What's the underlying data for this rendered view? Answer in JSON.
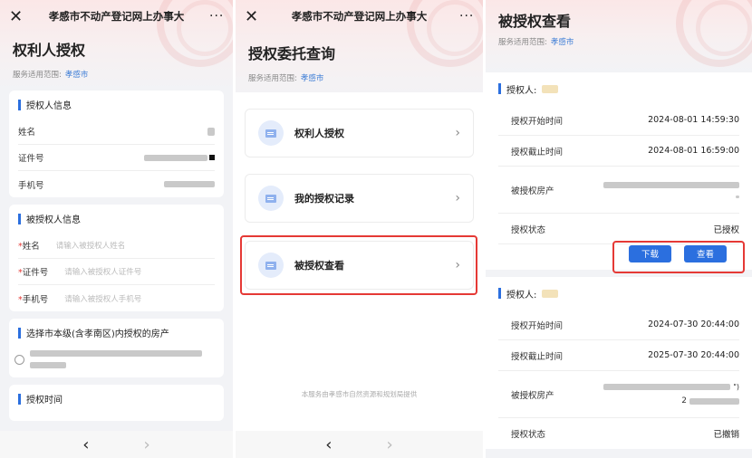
{
  "panel1": {
    "window_title": "孝感市不动产登记网上办事大",
    "close_glyph": "✕",
    "more_glyph": "···",
    "page_title": "权利人授权",
    "scope_label": "服务适用范围:",
    "scope_value": "孝感市",
    "grantor_section": {
      "title": "授权人信息",
      "fields": [
        {
          "label": "姓名"
        },
        {
          "label": "证件号"
        },
        {
          "label": "手机号"
        }
      ]
    },
    "grantee_section": {
      "title": "被授权人信息",
      "fields": [
        {
          "required": "*",
          "label": "姓名",
          "placeholder": "请输入被授权人姓名"
        },
        {
          "required": "*",
          "label": "证件号",
          "placeholder": "请输入被授权人证件号"
        },
        {
          "required": "*",
          "label": "手机号",
          "placeholder": "请输入被授权人手机号"
        }
      ]
    },
    "property_section": {
      "title": "选择市本级(含孝南区)内授权的房产"
    },
    "time_section": {
      "title": "授权时间"
    },
    "nav_back": "‹",
    "nav_forward": "›"
  },
  "panel2": {
    "window_title": "孝感市不动产登记网上办事大",
    "close_glyph": "✕",
    "more_glyph": "···",
    "page_title": "授权委托查询",
    "scope_label": "服务适用范围:",
    "scope_value": "孝感市",
    "menu": [
      {
        "label": "权利人授权"
      },
      {
        "label": "我的授权记录"
      },
      {
        "label": "被授权查看"
      }
    ],
    "chevron": "›",
    "footer": "本服务由孝感市自然资源和规划局提供",
    "nav_back": "‹",
    "nav_forward": "›"
  },
  "panel3": {
    "page_title": "被授权查看",
    "scope_label": "服务适用范围:",
    "scope_value": "孝感市",
    "records": [
      {
        "grantor_label": "授权人:",
        "start_label": "授权开始时间",
        "start_value": "2024-08-01 14:59:30",
        "end_label": "授权截止时间",
        "end_value": "2024-08-01 16:59:00",
        "property_label": "被授权房产",
        "status_label": "授权状态",
        "status_value": "已授权",
        "download_label": "下载",
        "view_label": "查看"
      },
      {
        "grantor_label": "授权人:",
        "start_label": "授权开始时间",
        "start_value": "2024-07-30 20:44:00",
        "end_label": "授权截止时间",
        "end_value": "2025-07-30 20:44:00",
        "property_label": "被授权房产",
        "property_partial_a": "\")",
        "property_partial_b": "2",
        "status_label": "授权状态",
        "status_value": "已撤销"
      }
    ]
  },
  "colors": {
    "accent": "#2b6fdf",
    "highlight": "#e53935",
    "granted": "#2e9a47",
    "revoked": "#e0703a"
  }
}
